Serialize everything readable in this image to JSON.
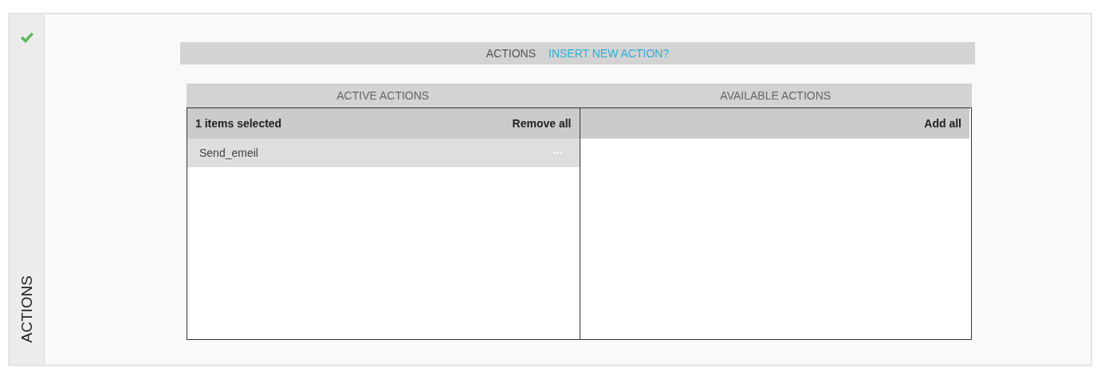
{
  "section": {
    "title": "ACTIONS",
    "valid": true
  },
  "header": {
    "label": "ACTIONS",
    "link": "INSERT NEW ACTION?"
  },
  "active": {
    "title": "ACTIVE ACTIONS",
    "count": "1 items selected",
    "action": "Remove all",
    "items": [
      {
        "name": "Send_emeil",
        "selected": true
      }
    ]
  },
  "available": {
    "title": "AVAILABLE ACTIONS",
    "action": "Add all"
  }
}
